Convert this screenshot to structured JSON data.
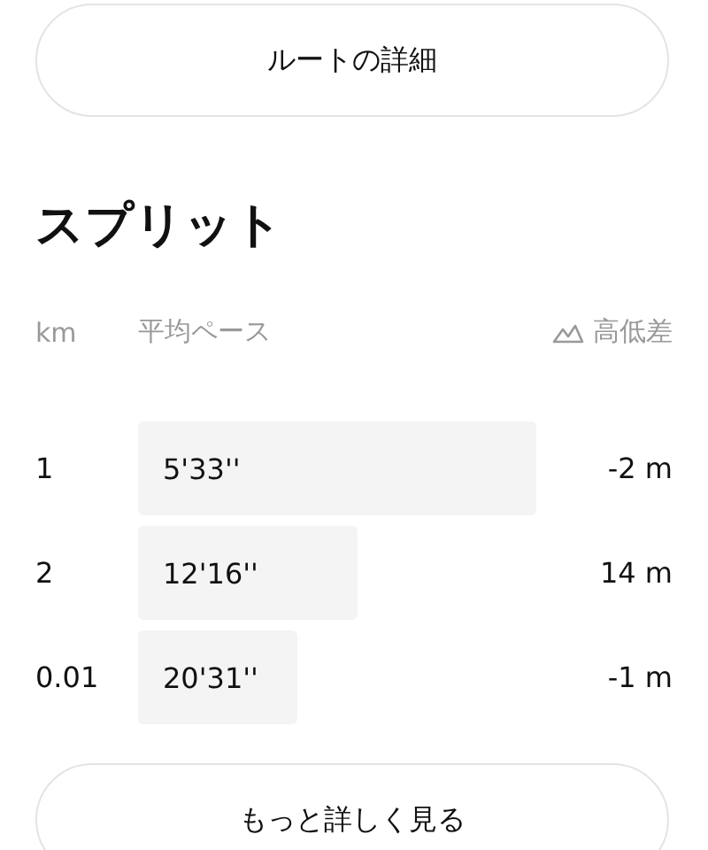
{
  "route_button": {
    "label": "ルートの詳細"
  },
  "section_title": "スプリット",
  "columns": {
    "distance": "km",
    "pace": "平均ペース",
    "elevation": "高低差"
  },
  "splits": [
    {
      "km": "1",
      "pace": "5'33''",
      "elevation": "-2 m"
    },
    {
      "km": "2",
      "pace": "12'16''",
      "elevation": "14 m"
    },
    {
      "km": "0.01",
      "pace": "20'31''",
      "elevation": "-1 m"
    }
  ],
  "more_button": {
    "label": "もっと詳しく見る"
  }
}
